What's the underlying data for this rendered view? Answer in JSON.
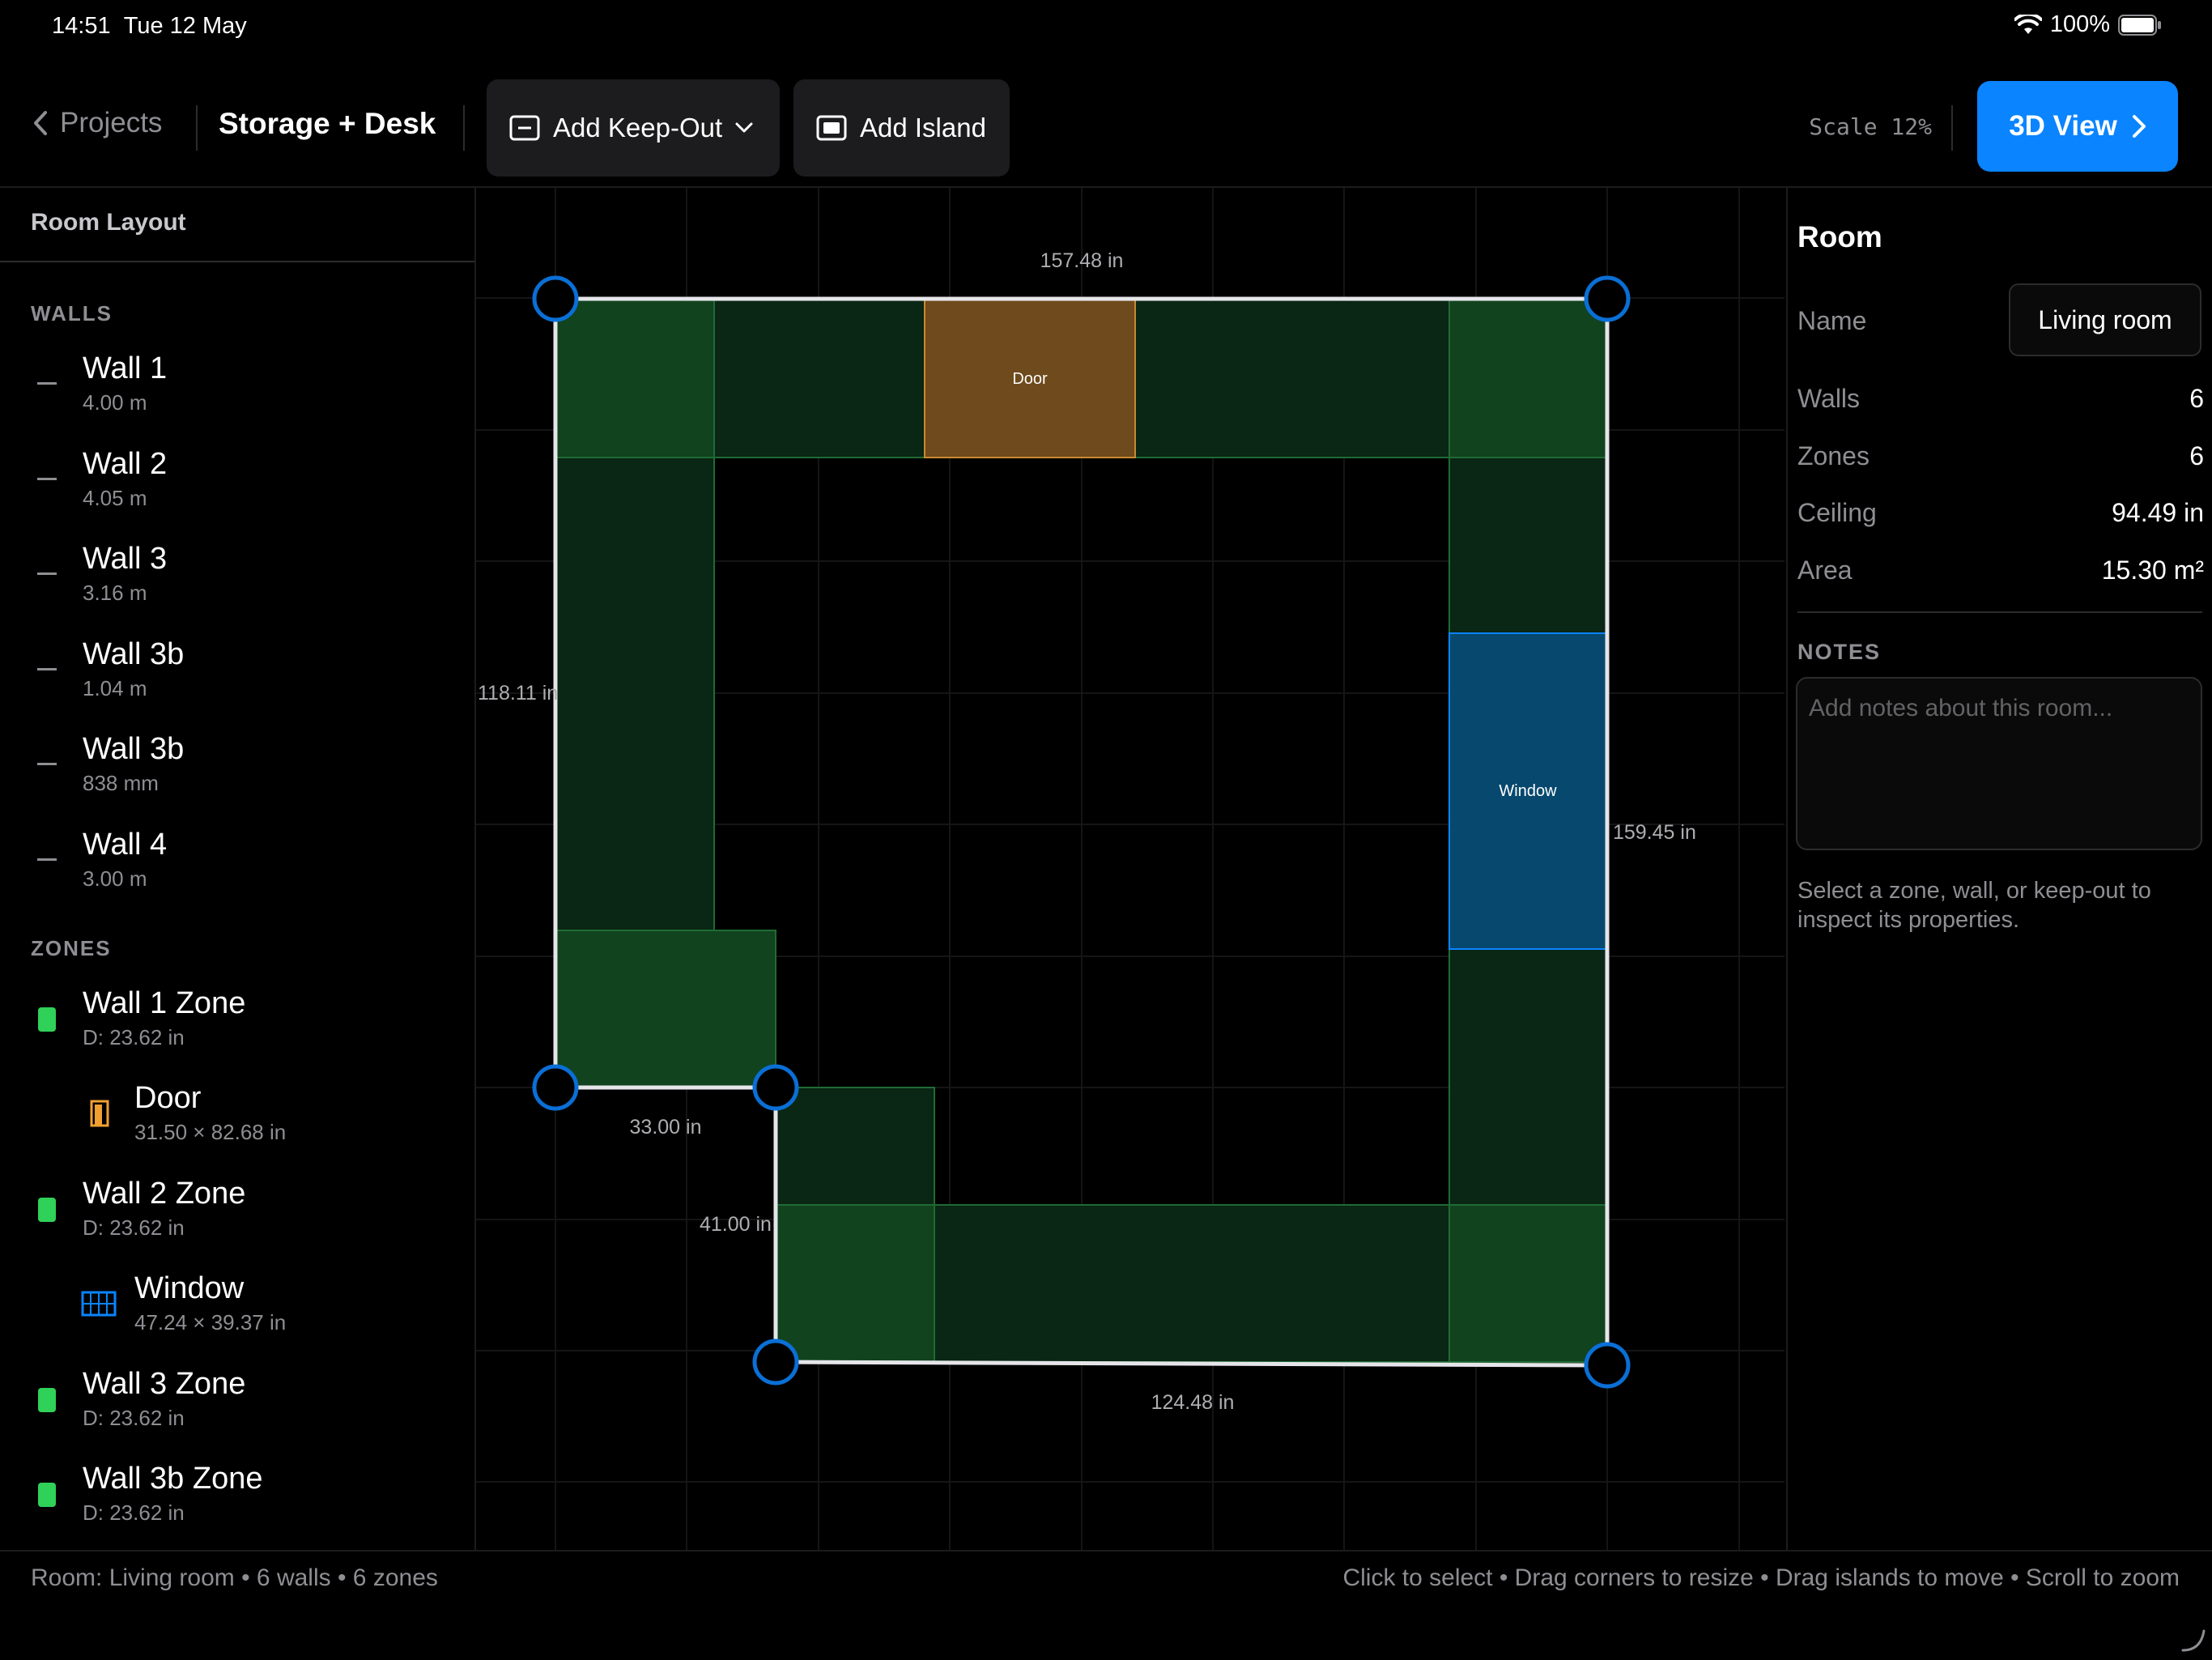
{
  "status": {
    "time": "14:51",
    "date": "Tue 12 May",
    "battery": "100%"
  },
  "toolbar": {
    "back_label": "Projects",
    "project_title": "Storage + Desk",
    "add_keepout": "Add Keep-Out",
    "add_island": "Add Island",
    "scale": "Scale 12%",
    "view3d": "3D View"
  },
  "sidebar": {
    "heading": "Room Layout",
    "walls_label": "WALLS",
    "walls": [
      {
        "label": "Wall 1",
        "sub": "4.00 m"
      },
      {
        "label": "Wall 2",
        "sub": "4.05 m"
      },
      {
        "label": "Wall 3",
        "sub": "3.16 m"
      },
      {
        "label": "Wall 3b",
        "sub": "1.04 m"
      },
      {
        "label": "Wall 3b",
        "sub": "838 mm"
      },
      {
        "label": "Wall 4",
        "sub": "3.00 m"
      }
    ],
    "zones_label": "ZONES",
    "zones": [
      {
        "label": "Wall 1 Zone",
        "sub": "D: 23.62 in",
        "icon": "zone-swatch"
      },
      {
        "label": "Door",
        "sub": "31.50 × 82.68 in",
        "icon": "door-icon"
      },
      {
        "label": "Wall 2 Zone",
        "sub": "D: 23.62 in",
        "icon": "zone-swatch"
      },
      {
        "label": "Window",
        "sub": "47.24 × 39.37 in",
        "icon": "window-icon"
      },
      {
        "label": "Wall 3 Zone",
        "sub": "D: 23.62 in",
        "icon": "zone-swatch"
      },
      {
        "label": "Wall 3b Zone",
        "sub": "D: 23.62 in",
        "icon": "zone-swatch"
      }
    ]
  },
  "canvas": {
    "dims": {
      "top": "157.48 in",
      "left": "118.11 in",
      "right": "159.45 in",
      "bottom": "124.48 in",
      "step_h": "33.00 in",
      "step_v": "41.00 in"
    },
    "door_label": "Door",
    "window_label": "Window"
  },
  "panel": {
    "title": "Room",
    "name_key": "Name",
    "name_value": "Living room",
    "rows": [
      {
        "key": "Walls",
        "value": "6"
      },
      {
        "key": "Zones",
        "value": "6"
      },
      {
        "key": "Ceiling",
        "value": "94.49 in"
      },
      {
        "key": "Area",
        "value": "15.30 m²"
      }
    ],
    "notes_label": "NOTES",
    "notes_placeholder": "Add notes about this room...",
    "hint": "Select a zone, wall, or keep-out to inspect its properties."
  },
  "footer": {
    "left": "Room: Living room • 6 walls • 6 zones",
    "right": "Click to select • Drag corners to resize • Drag islands to move • Scroll to zoom"
  },
  "colors": {
    "accent": "#0a84ff",
    "zone_fill": "#0f3d1c",
    "door": "#7a4f1a",
    "window": "#07486e"
  }
}
